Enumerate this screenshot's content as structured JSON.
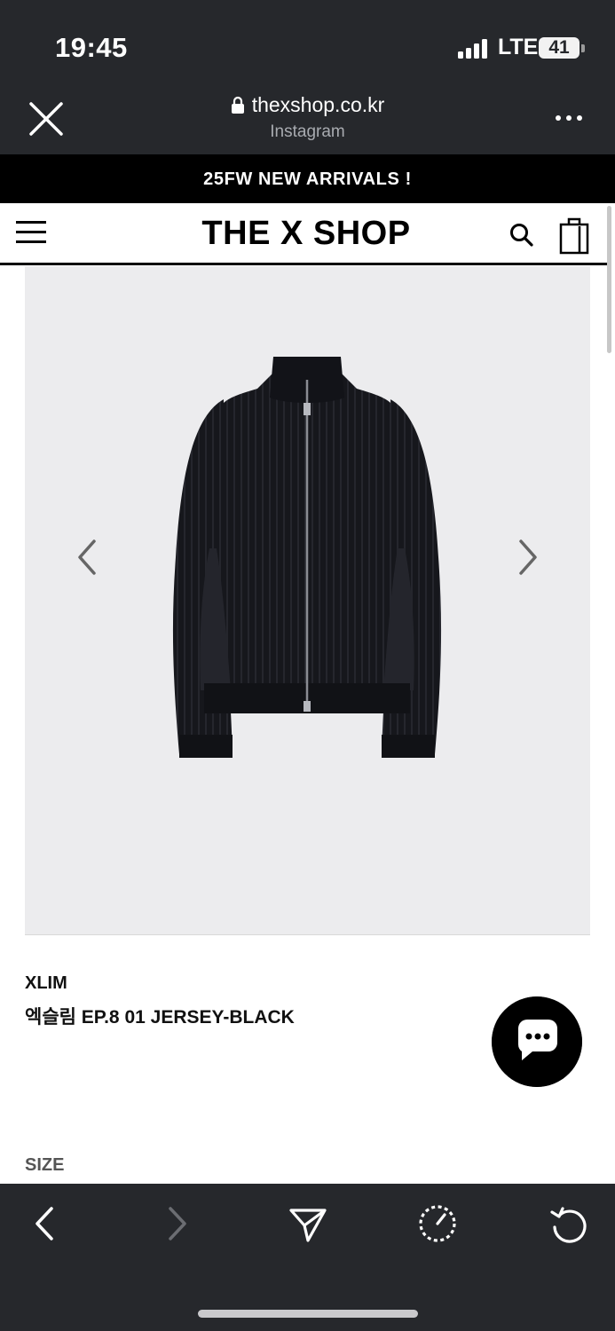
{
  "status_bar": {
    "time": "19:45",
    "network": "LTE",
    "battery": "41"
  },
  "browser": {
    "url": "thexshop.co.kr",
    "source": "Instagram"
  },
  "announcement": "25FW NEW ARRIVALS !",
  "header": {
    "logo": "THE X SHOP"
  },
  "product": {
    "brand": "XLIM",
    "name": "엑슬림 EP.8 01 JERSEY-BLACK",
    "size_label": "SIZE"
  },
  "colors": {
    "chrome": "#26282c",
    "image_bg": "#ececee",
    "accent": "#000000"
  },
  "icons": {
    "close": "close-icon",
    "lock": "lock-icon",
    "more": "more-icon",
    "menu": "hamburger-menu-icon",
    "search": "search-icon",
    "cart": "shopping-bag-icon",
    "prev": "chevron-left-icon",
    "next": "chevron-right-icon",
    "chat": "chat-bubble-icon",
    "share": "share-icon",
    "timer": "timer-icon",
    "reload": "reload-icon"
  }
}
